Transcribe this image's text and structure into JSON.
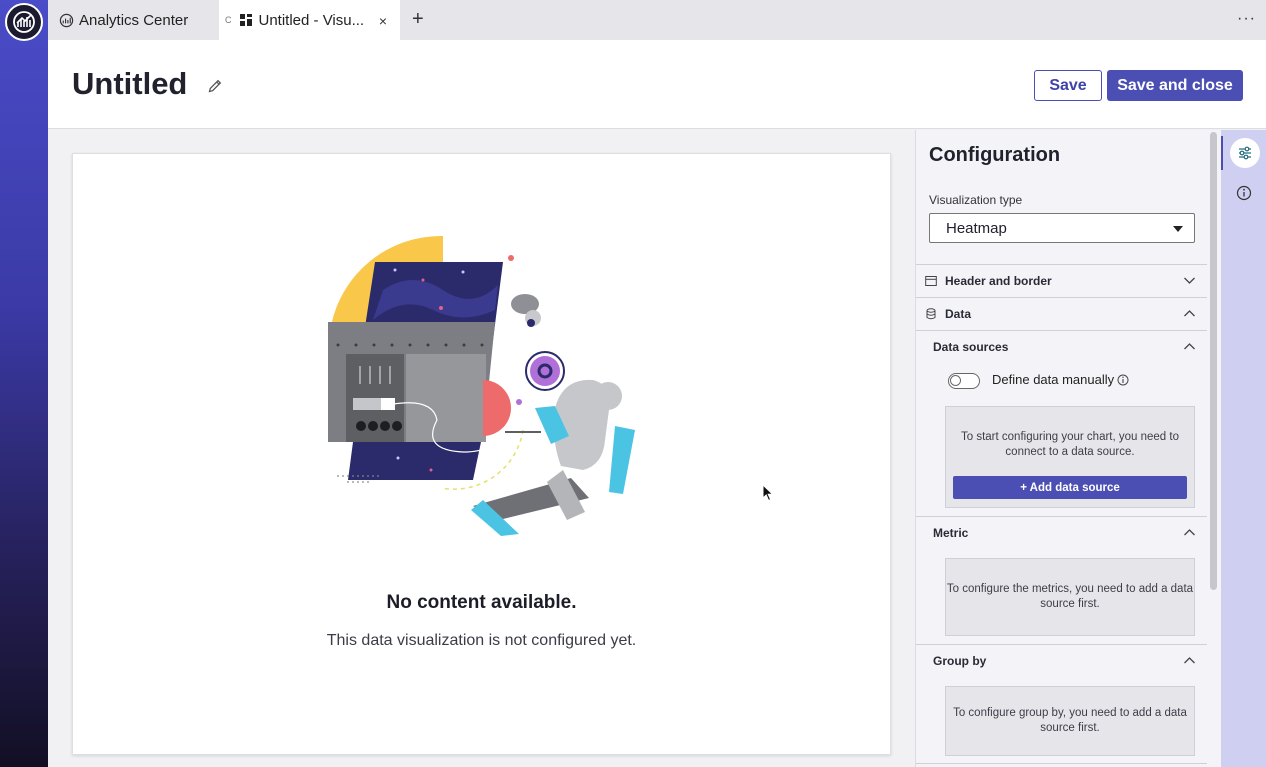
{
  "tabs": [
    {
      "label": "Analytics Center",
      "icon": "analytics-logo-icon"
    },
    {
      "label": "Untitled - Visu...",
      "icon": "dashboard-grid-icon",
      "close": "×"
    }
  ],
  "tab_add": "+",
  "tab_more": "···",
  "header": {
    "title": "Untitled",
    "save_label": "Save",
    "save_close_label": "Save and close"
  },
  "canvas": {
    "empty_title": "No content available.",
    "empty_subtitle": "This data visualization is not configured yet."
  },
  "config": {
    "title": "Configuration",
    "viz_type_label": "Visualization type",
    "viz_type_value": "Heatmap",
    "sections": {
      "header_border": "Header and border",
      "data": "Data",
      "data_sources": "Data sources",
      "define_manually": "Define data manually",
      "ds_empty": "To start configuring your chart, you need to connect to a data source.",
      "add_ds": "+ Add data source",
      "metric": "Metric",
      "metric_empty": "To configure the metrics, you need to add a data source first.",
      "group_by": "Group by",
      "group_by_empty": "To configure group by, you need to add a data source first."
    }
  },
  "colors": {
    "accent": "#4b4fb3",
    "rail_top": "#4a4cc8",
    "rail_bottom": "#120f24",
    "strip": "#cfd0f1"
  }
}
